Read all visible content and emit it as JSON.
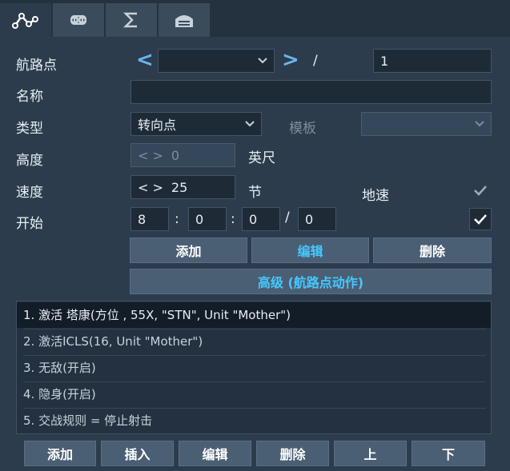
{
  "tabs": [
    {
      "icon": "waypoint-path-icon",
      "active": true
    },
    {
      "icon": "command-icon",
      "active": false
    },
    {
      "icon": "sigma-icon",
      "active": false
    },
    {
      "icon": "hangar-icon",
      "active": false
    }
  ],
  "waypoint": {
    "label": "航路点",
    "prev": "<",
    "next": ">",
    "selected": "",
    "separator": "/",
    "total": "1"
  },
  "name": {
    "label": "名称",
    "value": ""
  },
  "type": {
    "label": "类型",
    "value": "转向点",
    "template_label": "模板",
    "template_value": ""
  },
  "altitude": {
    "label": "高度",
    "stepper": "< >",
    "value": "0",
    "unit": "英尺"
  },
  "speed": {
    "label": "速度",
    "stepper": "< >",
    "value": "25",
    "unit": "节",
    "ground_label": "地速"
  },
  "start": {
    "label": "开始",
    "values": [
      "8",
      "0",
      "0",
      "0"
    ],
    "sep1": ":",
    "sep2": ":",
    "sep3": "/"
  },
  "actions": {
    "add": "添加",
    "edit": "编辑",
    "delete": "删除",
    "advanced": "高级 (航路点动作)"
  },
  "list_items": [
    "1. 激活 塔康(方位 , 55X, \"STN\", Unit \"Mother\")",
    "2. 激活ICLS(16, Unit \"Mother\")",
    "3. 无敌(开启)",
    "4. 隐身(开启)",
    "5. 交战规则 = 停止射击"
  ],
  "bottom": {
    "add": "添加",
    "insert": "插入",
    "edit": "编辑",
    "delete": "删除",
    "up": "上",
    "down": "下"
  },
  "colors": {
    "accent": "#46c8ff",
    "chevron": "#6ab4f0",
    "panel": "#2c3c4c"
  }
}
